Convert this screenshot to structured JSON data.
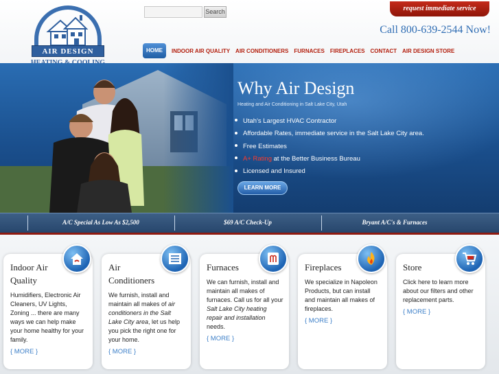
{
  "header": {
    "logo_name": "AIR DESIGN",
    "logo_sub": "HEATING & COOLING",
    "search_placeholder": "",
    "search_button": "Search",
    "request_button": "request immediate service",
    "phone": "Call 800-639-2544 Now!"
  },
  "nav": {
    "items": [
      {
        "label": "HOME",
        "active": true
      },
      {
        "label": "INDOOR AIR QUALITY"
      },
      {
        "label": "AIR CONDITIONERS"
      },
      {
        "label": "FURNACES"
      },
      {
        "label": "FIREPLACES"
      },
      {
        "label": "CONTACT"
      },
      {
        "label": "AIR DESIGN STORE"
      }
    ]
  },
  "hero": {
    "title": "Why Air Design",
    "subtitle": "Heating and Air Conditioning in Salt Lake City, Utah",
    "bullets": [
      "Utah's Largest HVAC Contractor",
      "Affordable Rates, immediate service in the Salt Lake City area.",
      "Free Estimates",
      "at the Better Business Bureau",
      "Licensed and Insured"
    ],
    "bullet_highlight": "A+ Rating",
    "learn_more": "LEARN MORE"
  },
  "specials": [
    "A/C Special As Low As $2,500",
    "$69 A/C Check-Up",
    "Bryant A/C's & Furnaces"
  ],
  "cards": [
    {
      "title": "Indoor Air Quality",
      "icon": "house-air-icon",
      "body": "Humidifiers, Electronic Air Cleaners, UV Lights, Zoning ... there are many ways we can help make your home healthy for your family.",
      "more": "{ MORE }"
    },
    {
      "title": "Air Conditioners",
      "icon": "ac-unit-icon",
      "body_1": "We furnish, install and maintain all makes of ",
      "body_italic": "air conditioners in the Salt Lake City area",
      "body_2": ", let us help you pick the right one for your home.",
      "more": "{ MORE }"
    },
    {
      "title": "Furnaces",
      "icon": "furnace-icon",
      "body_1": "We can furnish, install and maintain all makes of furnaces. Call us for all your ",
      "body_italic": "Salt Lake City heating repair and installation",
      "body_2": " needs.",
      "more": "{ MORE }"
    },
    {
      "title": "Fireplaces",
      "icon": "flame-icon",
      "body": "We specialize in Napoleon Products, but can install and maintain all makes of fireplaces.",
      "more": "{ MORE }"
    },
    {
      "title": "Store",
      "icon": "shopping-cart-icon",
      "body": "Click here to learn more about our filters and other replacement parts.",
      "more": "{ MORE }"
    }
  ],
  "colors": {
    "brand_blue": "#2f6db3",
    "nav_red": "#b3200f",
    "request_red": "#c42a1a",
    "highlight_red": "#ff3b2b",
    "link_blue": "#3c7fc8"
  }
}
